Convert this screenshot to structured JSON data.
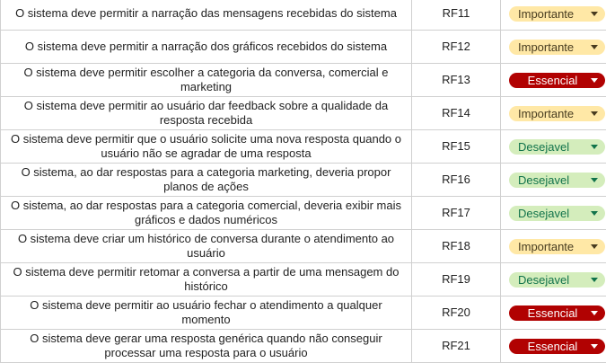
{
  "requirements": [
    {
      "description": "O sistema deve permitir a narração das mensagens recebidas do sistema",
      "code": "RF11",
      "priority": "Importante",
      "priority_type": "importante"
    },
    {
      "description": "O sistema deve permitir a narração dos gráficos recebidos do sistema",
      "code": "RF12",
      "priority": "Importante",
      "priority_type": "importante"
    },
    {
      "description": "O sistema deve permitir escolher a categoria da conversa, comercial e marketing",
      "code": "RF13",
      "priority": "Essencial",
      "priority_type": "essencial"
    },
    {
      "description": "O sistema deve permitir ao usuário dar feedback sobre a qualidade da resposta recebida",
      "code": "RF14",
      "priority": "Importante",
      "priority_type": "importante"
    },
    {
      "description": "O sistema deve permitir que o usuário solicite uma nova resposta quando o usuário não se agradar de uma resposta",
      "code": "RF15",
      "priority": "Desejavel",
      "priority_type": "desejavel"
    },
    {
      "description": "O sistema, ao dar respostas para a categoria marketing, deveria propor planos de ações",
      "code": "RF16",
      "priority": "Desejavel",
      "priority_type": "desejavel"
    },
    {
      "description": "O sistema, ao dar respostas para a categoria comercial, deveria exibir mais gráficos e  dados numéricos",
      "code": "RF17",
      "priority": "Desejavel",
      "priority_type": "desejavel"
    },
    {
      "description": "O sistema deve criar um histórico de conversa durante o atendimento ao usuário",
      "code": "RF18",
      "priority": "Importante",
      "priority_type": "importante"
    },
    {
      "description": "O sistema deve permitir retomar a conversa a partir de uma mensagem do histórico",
      "code": "RF19",
      "priority": "Desejavel",
      "priority_type": "desejavel"
    },
    {
      "description": "O sistema deve permitir ao usuário fechar o atendimento a qualquer momento",
      "code": "RF20",
      "priority": "Essencial",
      "priority_type": "essencial"
    },
    {
      "description": "O sistema deve gerar uma resposta genérica quando não conseguir processar uma resposta para o usuário",
      "code": "RF21",
      "priority": "Essencial",
      "priority_type": "essencial"
    }
  ],
  "colors": {
    "importante_bg": "#ffe8a6",
    "essencial_bg": "#b10202",
    "desejavel_bg": "#d4edbc",
    "grid_line": "#d0d0d0"
  }
}
